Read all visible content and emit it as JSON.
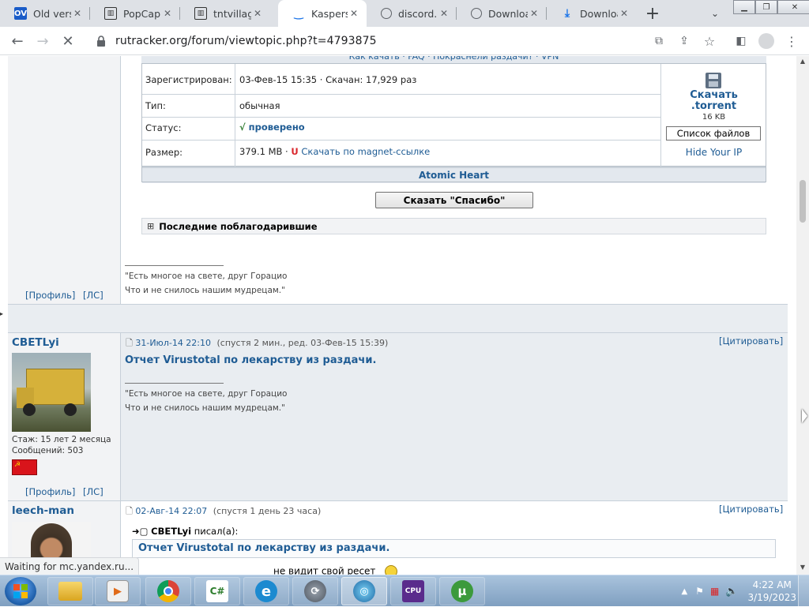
{
  "browser": {
    "tabs": [
      {
        "title": "Old versio",
        "favicon": "ov-logo-icon",
        "color": "#1a5cc8",
        "fav_text": "OV"
      },
      {
        "title": "PopCap G",
        "favicon": "tracker-icon",
        "color": "#333333"
      },
      {
        "title": "tntvillage",
        "favicon": "tracker-icon",
        "color": "#333333"
      },
      {
        "title": "Kaspersk",
        "favicon": "loading-icon",
        "color": "#1a73e8",
        "active": true
      },
      {
        "title": "discord.c",
        "favicon": "globe-icon",
        "color": "#5f6368"
      },
      {
        "title": "Downloa",
        "favicon": "globe-icon",
        "color": "#5f6368"
      },
      {
        "title": "Downloa",
        "favicon": "download-icon",
        "color": "#1a73e8"
      }
    ],
    "new_tab": "+",
    "url": "rutracker.org/forum/viewtopic.php?t=4793875",
    "status_text": "Waiting for mc.yandex.ru..."
  },
  "page": {
    "top_links": "Как качать · FAQ · Покраснели раздачи? · VPN",
    "info": {
      "registered_label": "Зарегистрирован:",
      "registered_value": "03-Фев-15 15:35",
      "downloaded": "Скачан: 17,929 раз",
      "type_label": "Тип:",
      "type_value": "обычная",
      "status_label": "Статус:",
      "status_check": "√",
      "status_value": "проверено",
      "size_label": "Размер:",
      "size_value": "379.1 MB",
      "magnet_icon": "U",
      "magnet_link": "Скачать по magnet-ссылке",
      "download_line1": "Скачать",
      "download_line2": ".torrent",
      "download_size": "16 KB",
      "file_list": "Список файлов",
      "hide_ip": "Hide Your IP",
      "title": "Atomic Heart"
    },
    "thanks_button": "Сказать \"Спасибо\"",
    "thanks_toggle": "⊞",
    "thanks_header": "Последние поблагодарившие",
    "signature_line1": "\"Есть многое на свете, друг Горацио",
    "signature_line2": "Что и не снилось нашим мудрецам.\"",
    "profile_link": "[Профиль]",
    "pm_link": "[ЛС]",
    "posts": [
      {
        "author": "CBETLyi",
        "experience": "Стаж: 15 лет 2 месяца",
        "messages": "Сообщений: 503",
        "date": "31-Июл-14 22:10",
        "meta": "(спустя 2 мин., ред. 03-Фев-15 15:39)",
        "quote": "[Цитировать]",
        "body": "Отчет Virustotal по лекарству из раздачи."
      },
      {
        "author": "leech-man",
        "date": "02-Авг-14 22:07",
        "meta": "(спустя 1 день 23 часа)",
        "quote": "[Цитировать]",
        "quote_author": "CBETLyi",
        "quote_wrote": "писал(а):",
        "quote_body": "Отчет Virustotal по лекарству из раздачи.",
        "partial_text": "не видит свой ресет"
      }
    ]
  },
  "taskbar": {
    "time": "4:22 AM",
    "date": "3/19/2023",
    "apps": [
      "explorer-icon",
      "media-player-icon",
      "chrome-icon",
      "csharp-icon",
      "edge-icon",
      "app-icon",
      "network-icon",
      "cpu-z-icon",
      "utorrent-icon"
    ]
  },
  "colors": {
    "link": "#1f5c94",
    "panel": "#f2f3f5",
    "header_row": "#e3e8ee"
  }
}
